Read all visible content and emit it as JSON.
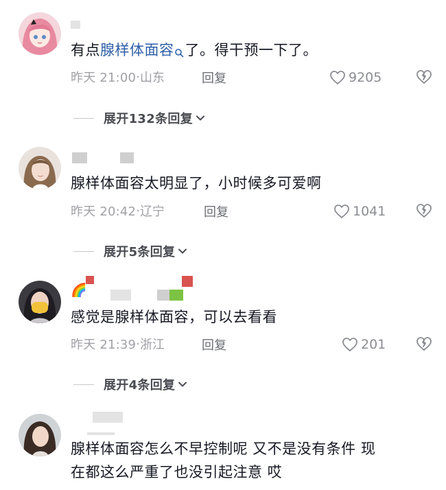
{
  "comments": [
    {
      "text_prefix": "有点",
      "keyword": "腺样体面容",
      "text_suffix": "了。得干预一下了。",
      "time": "昨天 21:00",
      "location": "山东",
      "reply_label": "回复",
      "likes": "9205",
      "expand_label": "展开132条回复"
    },
    {
      "text": "腺样体面容太明显了，小时候多可爱啊",
      "time": "昨天 20:42",
      "location": "辽宁",
      "reply_label": "回复",
      "likes": "1041",
      "expand_label": "展开5条回复"
    },
    {
      "name_emoji": "🌈",
      "text": "感觉是腺样体面容，可以去看看",
      "time": "昨天 21:39",
      "location": "浙江",
      "reply_label": "回复",
      "likes": "201",
      "expand_label": "展开4条回复"
    },
    {
      "text_line1": "腺样体面容怎么不早控制呢 又不是没有条件 现",
      "text_line2": "在都这么严重了也没引起注意 哎"
    }
  ],
  "icons": {
    "like": "heart-outline-icon",
    "dislike": "broken-heart-icon",
    "expand": "chevron-down-icon",
    "search": "search-icon"
  },
  "colors": {
    "keyword": "#2f5fa8",
    "meta": "#a0a0a6",
    "text": "#161823"
  }
}
